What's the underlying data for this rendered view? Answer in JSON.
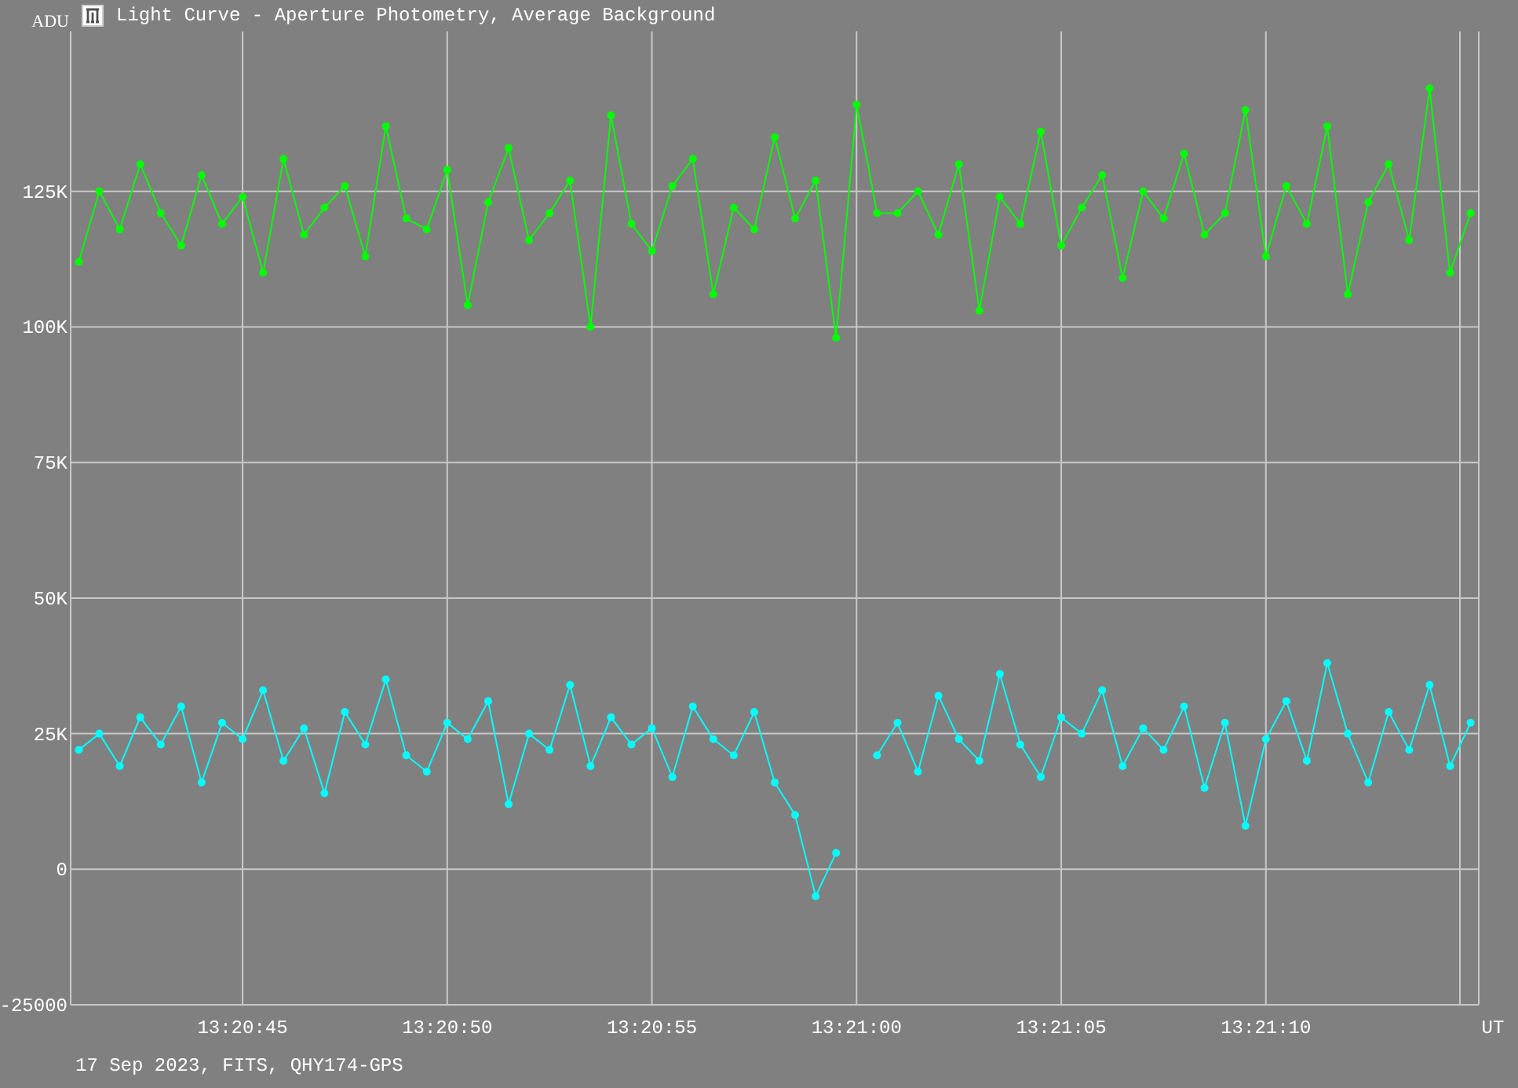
{
  "window": {
    "title": "Light Curve - Aperture Photometry, Average Background"
  },
  "chart": {
    "chart_data": {
      "type": "line",
      "grid": true,
      "xlabel": "UT",
      "ylabel": "ADU",
      "ylim": [
        -25000,
        154500
      ],
      "yticks": [
        {
          "value": -25000,
          "label": "-25000"
        },
        {
          "value": 0,
          "label": "0"
        },
        {
          "value": 25000,
          "label": "25K"
        },
        {
          "value": 50000,
          "label": "50K"
        },
        {
          "value": 75000,
          "label": "75K"
        },
        {
          "value": 100000,
          "label": "100K"
        },
        {
          "value": 125000,
          "label": "125K"
        }
      ],
      "categories": [
        null,
        null,
        null,
        null,
        null,
        null,
        null,
        null,
        "13:20:45",
        null,
        null,
        null,
        null,
        null,
        null,
        null,
        null,
        null,
        "13:20:50",
        null,
        null,
        null,
        null,
        null,
        null,
        null,
        null,
        null,
        "13:20:55",
        null,
        null,
        null,
        null,
        null,
        null,
        null,
        null,
        null,
        "13:21:00",
        null,
        null,
        null,
        null,
        null,
        null,
        null,
        null,
        null,
        "13:21:05",
        null,
        null,
        null,
        null,
        null,
        null,
        null,
        null,
        null,
        "13:21:10",
        null,
        null,
        null,
        null,
        null,
        null,
        null,
        null,
        null,
        null
      ],
      "series": [
        {
          "color": "#00ff00",
          "marker": "circle",
          "values": [
            112000,
            125000,
            118000,
            130000,
            121000,
            115000,
            128000,
            119000,
            124000,
            110000,
            131000,
            117000,
            122000,
            126000,
            113000,
            137000,
            120000,
            118000,
            129000,
            104000,
            123000,
            133000,
            116000,
            121000,
            127000,
            100000,
            139000,
            119000,
            114000,
            126000,
            131000,
            106000,
            122000,
            118000,
            135000,
            120000,
            127000,
            98000,
            141000,
            121000,
            121000,
            125000,
            117000,
            130000,
            103000,
            124000,
            119000,
            136000,
            115000,
            122000,
            128000,
            109000,
            125000,
            120000,
            132000,
            117000,
            121000,
            140000,
            113000,
            126000,
            119000,
            137000,
            106000,
            123000,
            130000,
            116000,
            144000,
            110000,
            121000
          ]
        },
        {
          "color": "#00ffff",
          "marker": "circle",
          "values": [
            22000,
            25000,
            19000,
            28000,
            23000,
            30000,
            16000,
            27000,
            24000,
            33000,
            20000,
            26000,
            14000,
            29000,
            23000,
            35000,
            21000,
            18000,
            27000,
            24000,
            31000,
            12000,
            25000,
            22000,
            34000,
            19000,
            28000,
            23000,
            26000,
            17000,
            30000,
            24000,
            21000,
            29000,
            16000,
            10000,
            -5000,
            3000,
            null,
            21000,
            27000,
            18000,
            32000,
            24000,
            20000,
            36000,
            23000,
            17000,
            28000,
            25000,
            33000,
            19000,
            26000,
            22000,
            30000,
            15000,
            27000,
            8000,
            24000,
            31000,
            20000,
            38000,
            25000,
            16000,
            29000,
            22000,
            34000,
            19000,
            27000
          ]
        }
      ]
    }
  },
  "footer": "17 Sep 2023, FITS, QHY174-GPS"
}
